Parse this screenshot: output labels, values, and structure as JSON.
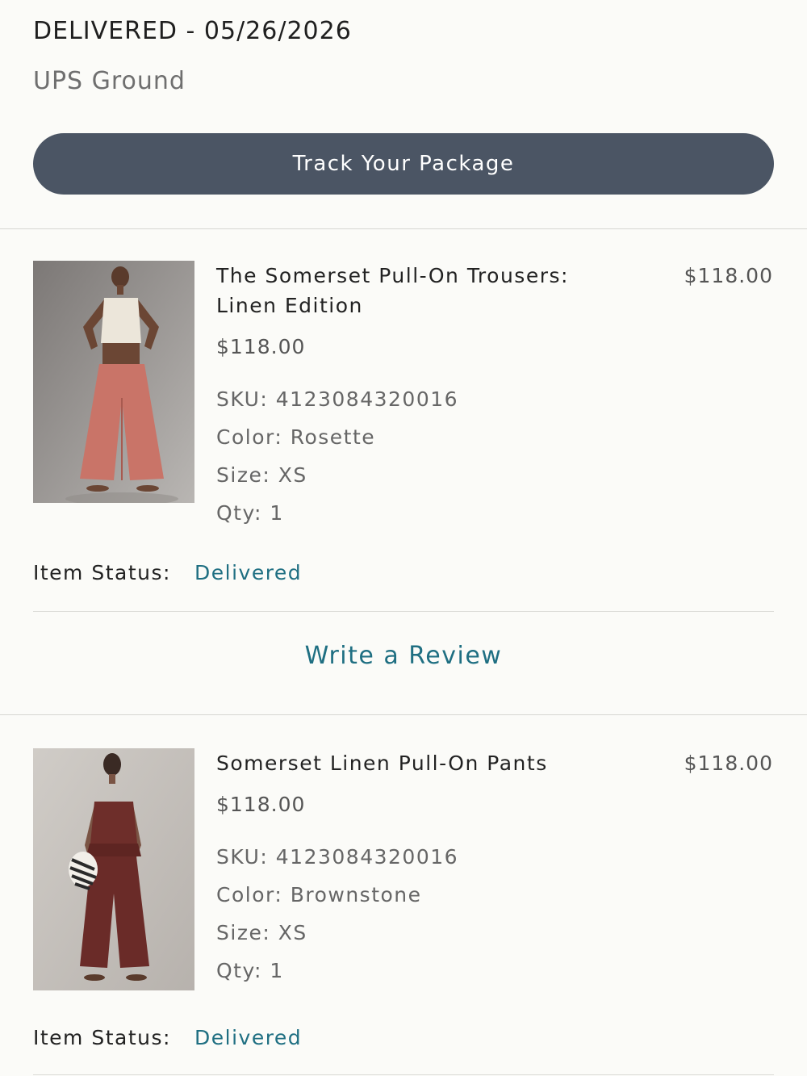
{
  "shipment": {
    "status_date": "DELIVERED - 05/26/2026",
    "carrier": "UPS Ground",
    "track_label": "Track Your Package"
  },
  "items": [
    {
      "name_line1": "The Somerset Pull-On Trousers:",
      "name_line2": "Linen Edition",
      "unit_price": "$118.00",
      "total_price": "$118.00",
      "sku": "SKU: 4123084320016",
      "color": "Color: Rosette",
      "size": "Size: XS",
      "qty": "Qty: 1",
      "status_label": "Item Status:",
      "status_value": "Delivered",
      "review_label": "Write a Review"
    },
    {
      "name_line1": "Somerset Linen Pull-On Pants",
      "unit_price": "$118.00",
      "total_price": "$118.00",
      "sku": "SKU: 4123084320016",
      "color": "Color: Brownstone",
      "size": "Size: XS",
      "qty": "Qty: 1",
      "status_label": "Item Status:",
      "status_value": "Delivered"
    }
  ],
  "colors": {
    "button_bg": "#4b5564",
    "link": "#1f6f82",
    "background": "#fbfbf8"
  }
}
